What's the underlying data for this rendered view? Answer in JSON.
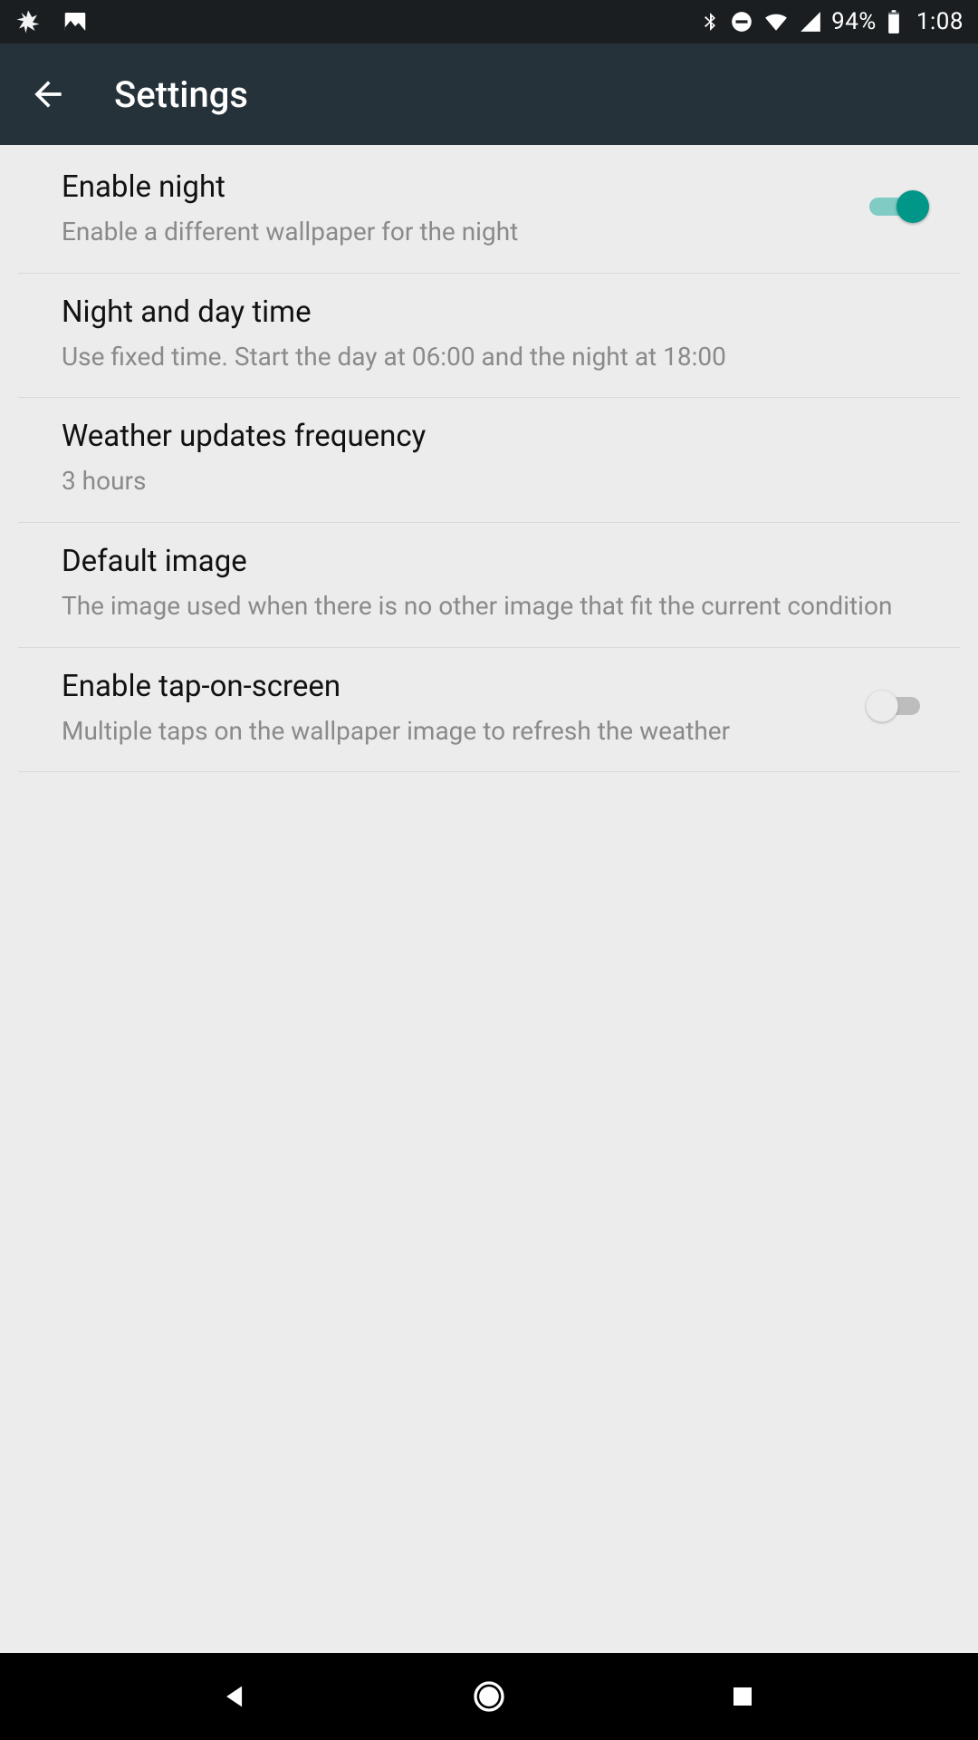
{
  "status_bar": {
    "battery_pct": "94%",
    "clock": "1:08"
  },
  "app_bar": {
    "title": "Settings"
  },
  "settings": [
    {
      "title": "Enable night",
      "sub": "Enable a different wallpaper for the night",
      "has_switch": true,
      "switch_on": true,
      "name": "enable-night"
    },
    {
      "title": "Night and day time",
      "sub": "Use fixed time. Start the day at 06:00 and the night at 18:00",
      "has_switch": false,
      "name": "night-day-time"
    },
    {
      "title": "Weather updates frequency",
      "sub": "3 hours",
      "has_switch": false,
      "name": "weather-updates-frequency"
    },
    {
      "title": "Default image",
      "sub": "The image used when there is no other image that fit the current condition",
      "has_switch": false,
      "name": "default-image"
    },
    {
      "title": "Enable tap-on-screen",
      "sub": "Multiple taps on the wallpaper image to refresh the weather",
      "has_switch": true,
      "switch_on": false,
      "name": "enable-tap-on-screen"
    }
  ]
}
